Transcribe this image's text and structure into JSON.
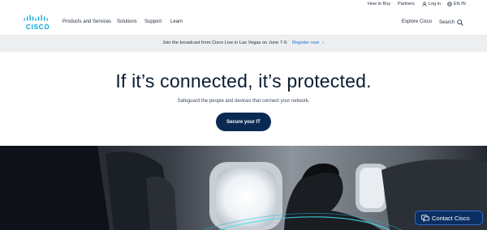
{
  "utility_bar": {
    "how_to_buy": "How to Buy",
    "partners": "Partners",
    "login": "Log in",
    "language": "EN IN"
  },
  "nav": {
    "logo_text": "CISCO",
    "products": "Products and Services",
    "solutions": "Solutions",
    "support": "Support",
    "learn": "Learn",
    "explore": "Explore Cisco",
    "search": "Search"
  },
  "announcement": {
    "text": "Join the broadcast from Cisco Live in Las Vegas on June 7-9.",
    "link": "Register now",
    "link_arrow": "›"
  },
  "hero": {
    "title": "If it’s connected, it’s protected.",
    "subtitle": "Safeguard the people and devices that connect your network.",
    "cta": "Secure your IT"
  },
  "contact": {
    "label": "Contact Cisco"
  },
  "colors": {
    "brand_blue": "#049fd9",
    "cta_navy": "#0a2a54",
    "link_blue": "#1b6fd1",
    "announce_bg": "#eceef0"
  }
}
